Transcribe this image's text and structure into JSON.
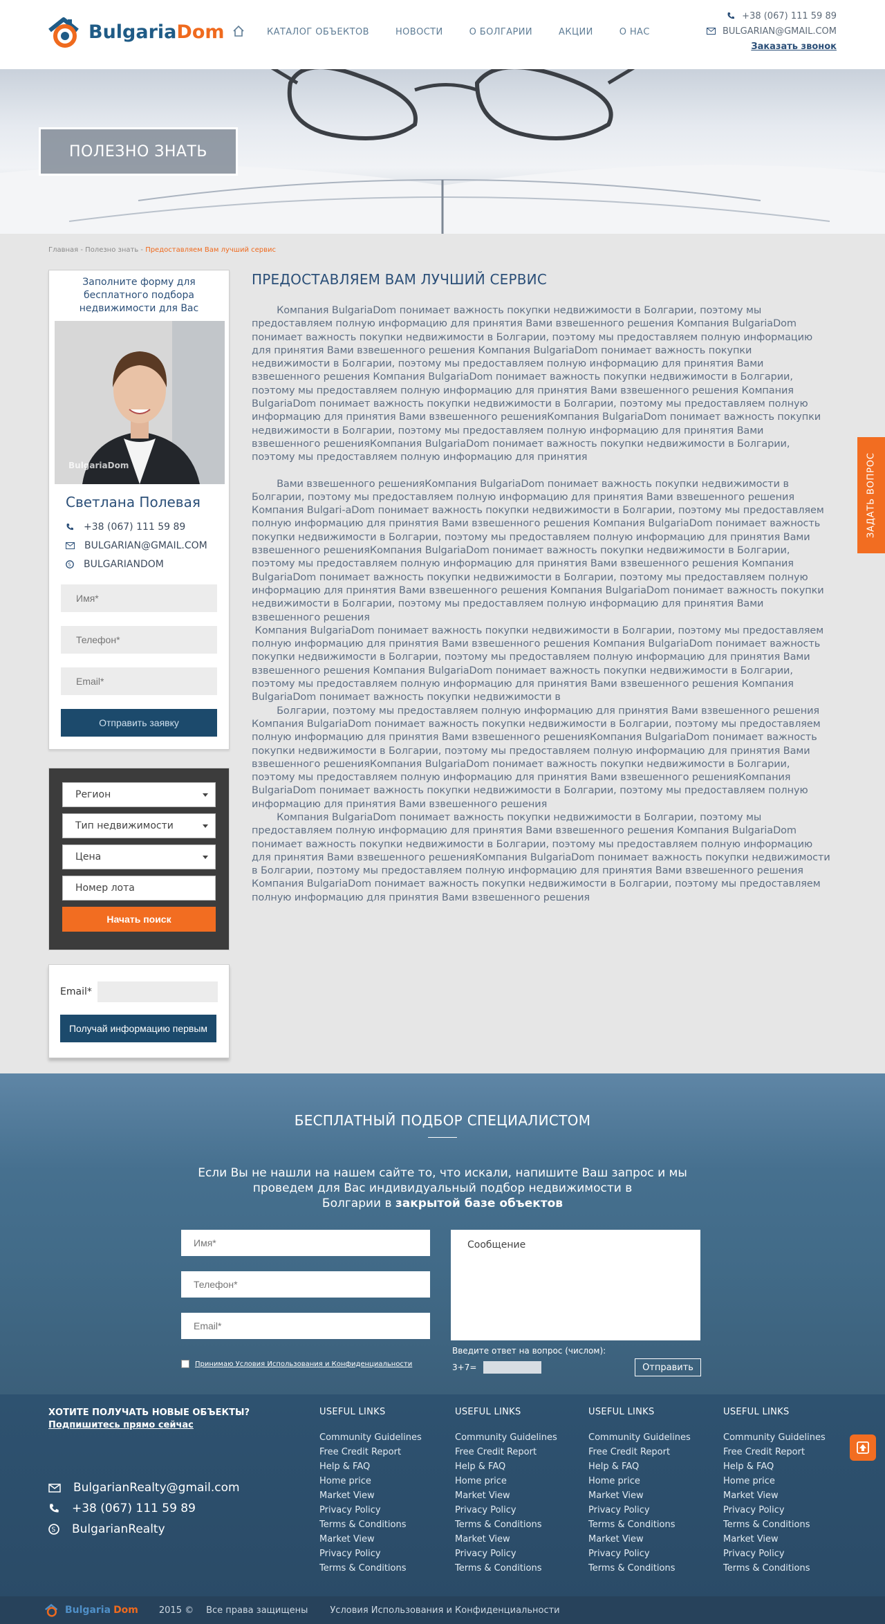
{
  "header": {
    "logo": {
      "part1": "Bulgaria",
      "part2": "Dom"
    },
    "nav": [
      "КАТАЛОГ ОБЪЕКТОВ",
      "НОВОСТИ",
      "О БОЛГАРИИ",
      "АКЦИИ",
      "О НАС"
    ],
    "phone": "+38 (067) 111 59 89",
    "email": "BULGARIAN@GMAIL.COM",
    "callback": "Заказать звонок"
  },
  "hero": {
    "title": "ПОЛЕЗНО ЗНАТЬ"
  },
  "breadcrumb": {
    "home": "Главная",
    "sep": " - ",
    "section": "Полезно знать",
    "current": "Предоставляем Вам лучший сервис"
  },
  "agent": {
    "intro": "Заполните форму для бесплатного подбора недвижимости для Вас",
    "watermark": "BulgariaDom",
    "name": "Светлана Полевая",
    "phone": "+38 (067) 111 59 89",
    "email": "BULGARIAN@GMAIL.COM",
    "skype": "BULGARIANDOM",
    "form": {
      "name_ph": "Имя*",
      "phone_ph": "Телефон*",
      "email_ph": "Email*",
      "submit": "Отправить заявку"
    }
  },
  "search": {
    "region": "Регион",
    "type": "Тип недвижимости",
    "price": "Цена",
    "lot_ph": "Номер лота",
    "submit": "Начать поиск"
  },
  "subscribe": {
    "label": "Email*",
    "button": "Получай информацию первым"
  },
  "article": {
    "title": "ПРЕДОСТАВЛЯЕМ ВАМ ЛУЧШИЙ СЕРВИС",
    "p1": "        Компания BulgariaDom понимает важность покупки недвижимости в Болгарии, поэтому мы предоставляем полную информацию для принятия Вами взвешенного решения Компания BulgariaDom понимает важность покупки недвижимости в Болгарии, поэтому мы предоставляем полную информацию для принятия Вами взвешенного решения Компания BulgariaDom понимает важность покупки недвижимости в Болгарии, поэтому мы предоставляем полную информацию для принятия Вами взвешенного решения Компания BulgariaDom понимает важность покупки недвижимости в Болгарии, поэтому мы предоставляем полную информацию для принятия Вами взвешенного решения Компания BulgariaDom понимает важность покупки недвижимости в Болгарии, поэтому мы предоставляем полную информацию для принятия Вами взвешенного решенияКомпания BulgariaDom понимает важность покупки недвижимости в Болгарии, поэтому мы предоставляем полную информацию для принятия Вами взвешенного решенияКомпания BulgariaDom понимает важность покупки недвижимости в Болгарии, поэтому мы предоставляем полную информацию для принятия",
    "p2": "        Вами взвешенного решенияКомпания BulgariaDom понимает важность покупки недвижимости в Болгарии, поэтому мы предоставляем полную информацию для принятия Вами взвешенного решения Компания Bulgari-aDom понимает важность покупки недвижимости в Болгарии, поэтому мы предоставляем полную информацию для принятия Вами взвешенного решения Компания BulgariaDom понимает важность покупки недвижимости в Болгарии, поэтому мы предоставляем полную информацию для принятия Вами взвешенного решенияКомпания BulgariaDom понимает важность покупки недвижимости в Болгарии, поэтому мы предоставляем полную информацию для принятия Вами взвешенного решения Компания BulgariaDom понимает важность покупки недвижимости в Болгарии, поэтому мы предоставляем полную информацию для принятия Вами взвешенного решения Компания BulgariaDom понимает важность покупки недвижимости в Болгарии, поэтому мы предоставляем полную информацию для принятия Вами взвешенного решения",
    "p3": " Компания BulgariaDom понимает важность покупки недвижимости в Болгарии, поэтому мы предоставляем полную информацию для принятия Вами взвешенного решения Компания BulgariaDom понимает важность покупки недвижимости в Болгарии, поэтому мы предоставляем полную информацию для принятия Вами взвешенного решения Компания BulgariaDom понимает важность покупки недвижимости в Болгарии, поэтому мы предоставляем полную информацию для принятия Вами взвешенного решения Компания BulgariaDom понимает важность покупки недвижимости в",
    "p4": "        Болгарии, поэтому мы предоставляем полную информацию для принятия Вами взвешенного решения Компания BulgariaDom понимает важность покупки недвижимости в Болгарии, поэтому мы предоставляем полную информацию для принятия Вами взвешенного решенияКомпания BulgariaDom понимает важность покупки недвижимости в Болгарии, поэтому мы предоставляем полную информацию для принятия Вами взвешенного решенияКомпания BulgariaDom понимает важность покупки недвижимости в Болгарии, поэтому мы предоставляем полную информацию для принятия Вами взвешенного решенияКомпания BulgariaDom понимает важность покупки недвижимости в Болгарии, поэтому мы предоставляем полную информацию для принятия Вами взвешенного решения",
    "p5": "        Компания BulgariaDom понимает важность покупки недвижимости в Болгарии, поэтому мы предоставляем полную информацию для принятия Вами взвешенного решения Компания BulgariaDom понимает важность покупки недвижимости в Болгарии, поэтому мы предоставляем полную информацию для принятия Вами взвешенного решенияКомпания BulgariaDom понимает важность покупки недвижимости в Болгарии, поэтому мы предоставляем полную информацию для принятия Вами взвешенного решения Компания BulgariaDom понимает важность покупки недвижимости в Болгарии, поэтому мы предоставляем полную информацию для принятия Вами взвешенного решения"
  },
  "ask_tab": "ЗАДАТЬ ВОПРОС",
  "free_selection": {
    "title": "БЕСПЛАТНЫЙ ПОДБОР СПЕЦИАЛИСТОМ",
    "lead1": "Если Вы не нашли на нашем сайте то, что искали, напишите Ваш запрос и мы проведем для Вас индивидуальный подбор недвижимости в",
    "lead2": "Болгарии в ",
    "lead_bold": "закрытой базе объектов",
    "name_ph": "Имя*",
    "phone_ph": "Телефон*",
    "email_ph": "Email*",
    "message_ph": "Сообщение",
    "agree": "Принимаю Условия Использования и Конфиденциальности",
    "question": "Введите ответ на вопрос (числом):",
    "captcha": "3+7=",
    "submit": "Отправить"
  },
  "footer": {
    "sub_title": "ХОТИТЕ ПОЛУЧАТЬ НОВЫЕ ОБЪЕКТЫ?",
    "sub_link": "Подпишитесь прямо сейчас",
    "email": "BulgarianRealty@gmail.com",
    "phone": "+38 (067) 111 59 89",
    "skype": "BulgarianRealty",
    "columns": [
      {
        "title": "USEFUL LINKS",
        "links": [
          "Community Guidelines",
          "Free Credit Report",
          "Help & FAQ",
          "Home price",
          "Market View",
          "Privacy Policy",
          "Terms & Conditions",
          "Market View",
          "Privacy Policy",
          "Terms & Conditions"
        ]
      },
      {
        "title": "USEFUL LINKS",
        "links": [
          "Community Guidelines",
          "Free Credit Report",
          "Help & FAQ",
          "Home price",
          "Market View",
          "Privacy Policy",
          "Terms & Conditions",
          "Market View",
          "Privacy Policy",
          "Terms & Conditions"
        ]
      },
      {
        "title": "USEFUL LINKS",
        "links": [
          "Community Guidelines",
          "Free Credit Report",
          "Help & FAQ",
          "Home price",
          "Market View",
          "Privacy Policy",
          "Terms & Conditions",
          "Market View",
          "Privacy Policy",
          "Terms & Conditions"
        ]
      },
      {
        "title": "USEFUL LINKS",
        "links": [
          "Community Guidelines",
          "Free Credit Report",
          "Help & FAQ",
          "Home price",
          "Market View",
          "Privacy Policy",
          "Terms & Conditions",
          "Market View",
          "Privacy Policy",
          "Terms & Conditions"
        ]
      }
    ],
    "bottom": {
      "logo1": "Bulgaria",
      "logo2": "Dom",
      "year": "2015 ©",
      "rights": "Все права защищены",
      "terms": "Условия Использования и Конфиденциальности"
    }
  },
  "colors": {
    "accent": "#f26d21",
    "brand": "#1f5b86",
    "dark_button": "#1c4a6c"
  }
}
